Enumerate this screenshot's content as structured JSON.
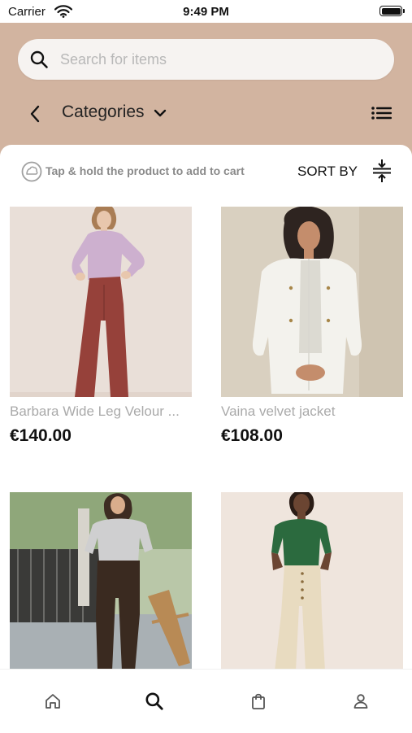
{
  "status_bar": {
    "carrier": "Carrier",
    "time": "9:49 PM"
  },
  "search": {
    "placeholder": "Search for items",
    "value": ""
  },
  "nav": {
    "title": "Categories"
  },
  "hint": {
    "text": "Tap & hold the product to add to cart"
  },
  "sort": {
    "label": "SORT BY"
  },
  "products": [
    {
      "name": "Barbara Wide Leg Velour ...",
      "price": "€140.00"
    },
    {
      "name": "Vaina velvet jacket",
      "price": "€108.00"
    },
    {
      "name": "",
      "price": ""
    },
    {
      "name": "",
      "price": ""
    }
  ],
  "colors": {
    "header": "#d2b4a0",
    "accent": "#111111"
  },
  "tabbar": {
    "icons": [
      "home-icon",
      "search-icon",
      "bag-icon",
      "profile-icon"
    ],
    "active": "search-icon"
  }
}
